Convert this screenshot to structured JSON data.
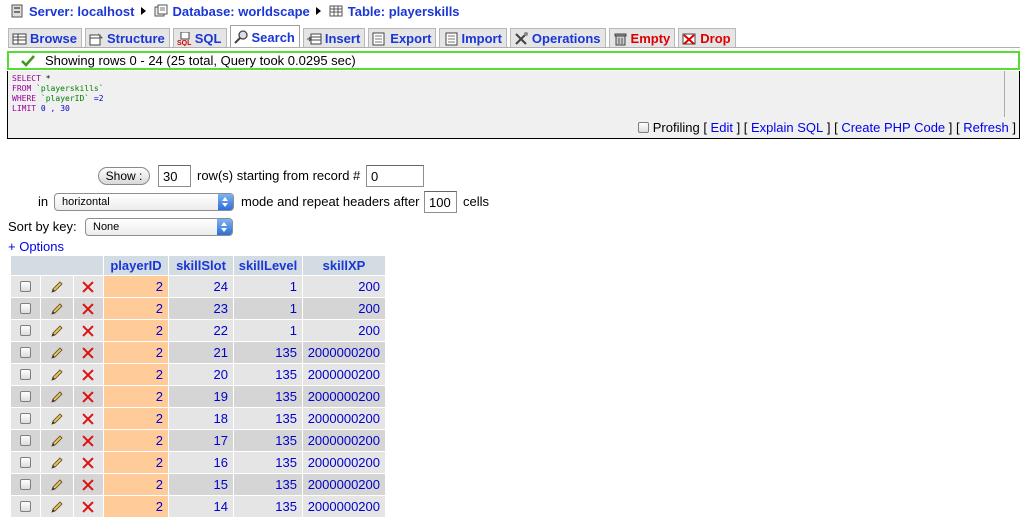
{
  "breadcrumb": {
    "server": "Server: localhost",
    "database": "Database: worldscape",
    "table": "Table: playerskills"
  },
  "tabs": [
    {
      "label": "Browse",
      "icon": "browse-icon"
    },
    {
      "label": "Structure",
      "icon": "structure-icon"
    },
    {
      "label": "SQL",
      "icon": "sql-icon"
    },
    {
      "label": "Search",
      "icon": "search-icon",
      "active": true
    },
    {
      "label": "Insert",
      "icon": "insert-icon"
    },
    {
      "label": "Export",
      "icon": "export-icon"
    },
    {
      "label": "Import",
      "icon": "import-icon"
    },
    {
      "label": "Operations",
      "icon": "operations-icon"
    },
    {
      "label": "Empty",
      "icon": "empty-icon",
      "danger": true
    },
    {
      "label": "Drop",
      "icon": "drop-icon",
      "danger": true
    }
  ],
  "message": "Showing rows 0 - 24 (25 total, Query took 0.0295 sec)",
  "sql": {
    "select": "SELECT",
    "star": "*",
    "from": "FROM",
    "table": "`playerskills`",
    "where": "WHERE",
    "column": "`playerID`",
    "eq_value": "=2",
    "limit": "LIMIT",
    "limit_args": "0 , 30"
  },
  "sql_links": {
    "profiling": "Profiling",
    "edit": "Edit",
    "explain": "Explain SQL",
    "create_php": "Create PHP Code",
    "refresh": "Refresh"
  },
  "nav_form": {
    "show_button": "Show :",
    "rows_value": "30",
    "rows_label": "row(s) starting from record #",
    "start_value": "0",
    "in_label": "in",
    "mode_value": "horizontal",
    "mode_label": "mode and repeat headers after",
    "repeat_value": "100",
    "cells_label": "cells",
    "sort_label": "Sort by key:",
    "sort_value": "None",
    "options_link": "+ Options"
  },
  "table": {
    "columns": [
      "playerID",
      "skillSlot",
      "skillLevel",
      "skillXP"
    ],
    "rows": [
      [
        "2",
        "24",
        "1",
        "200"
      ],
      [
        "2",
        "23",
        "1",
        "200"
      ],
      [
        "2",
        "22",
        "1",
        "200"
      ],
      [
        "2",
        "21",
        "135",
        "2000000200"
      ],
      [
        "2",
        "20",
        "135",
        "2000000200"
      ],
      [
        "2",
        "19",
        "135",
        "2000000200"
      ],
      [
        "2",
        "18",
        "135",
        "2000000200"
      ],
      [
        "2",
        "17",
        "135",
        "2000000200"
      ],
      [
        "2",
        "16",
        "135",
        "2000000200"
      ],
      [
        "2",
        "15",
        "135",
        "2000000200"
      ],
      [
        "2",
        "14",
        "135",
        "2000000200"
      ]
    ]
  },
  "colors": {
    "link": "#1a36d6",
    "danger": "#dd0000",
    "success_border": "#55dd33",
    "header_bg": "#d3dce3",
    "row_odd": "#e5e5e5",
    "row_even": "#d5d5d5",
    "pk_highlight": "#ffcc99"
  }
}
